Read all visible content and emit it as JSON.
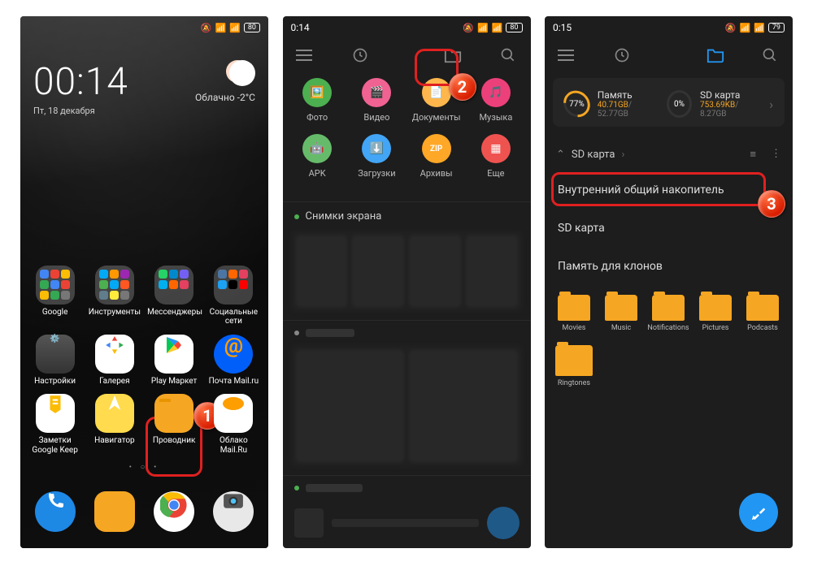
{
  "phone1": {
    "time": "00:14",
    "date": "Пт, 18 декабря",
    "weather": "Облачно -2°C",
    "battery": "80",
    "folders": {
      "google": "Google",
      "tools": "Инструменты",
      "messengers": "Мессенджеры",
      "social": "Социальные сети"
    },
    "apps": {
      "settings": "Настройки",
      "gallery": "Галерея",
      "playmarket": "Play Маркет",
      "mailru": "Почта Mail.ru",
      "keep": "Заметки Google Keep",
      "navigator": "Навигатор",
      "files": "Проводник",
      "cloud": "Облако Mail.Ru"
    },
    "callout_num": "1"
  },
  "phone2": {
    "time": "0:14",
    "battery": "80",
    "cats": {
      "photo": "Фото",
      "video": "Видео",
      "docs": "Документы",
      "music": "Музыка",
      "apk": "APK",
      "downloads": "Загрузки",
      "archives": "Архивы",
      "more": "Еще"
    },
    "section1": "Снимки экрана",
    "callout_num": "2"
  },
  "phone3": {
    "time": "0:15",
    "battery": "79",
    "storage": {
      "internal": {
        "pct": "77%",
        "label": "Память",
        "used": "40.71GB",
        "total": "52.77GB"
      },
      "sd": {
        "pct": "0%",
        "label": "SD карта",
        "used": "753.69KB",
        "total": "8.27GB"
      }
    },
    "path": "SD карта",
    "list": {
      "internal": "Внутренний общий накопитель",
      "sd": "SD карта",
      "clones": "Память для клонов"
    },
    "folders": [
      "Movies",
      "Music",
      "Notifications",
      "Pictures",
      "Podcasts",
      "Ringtones"
    ],
    "callout_num": "3"
  }
}
